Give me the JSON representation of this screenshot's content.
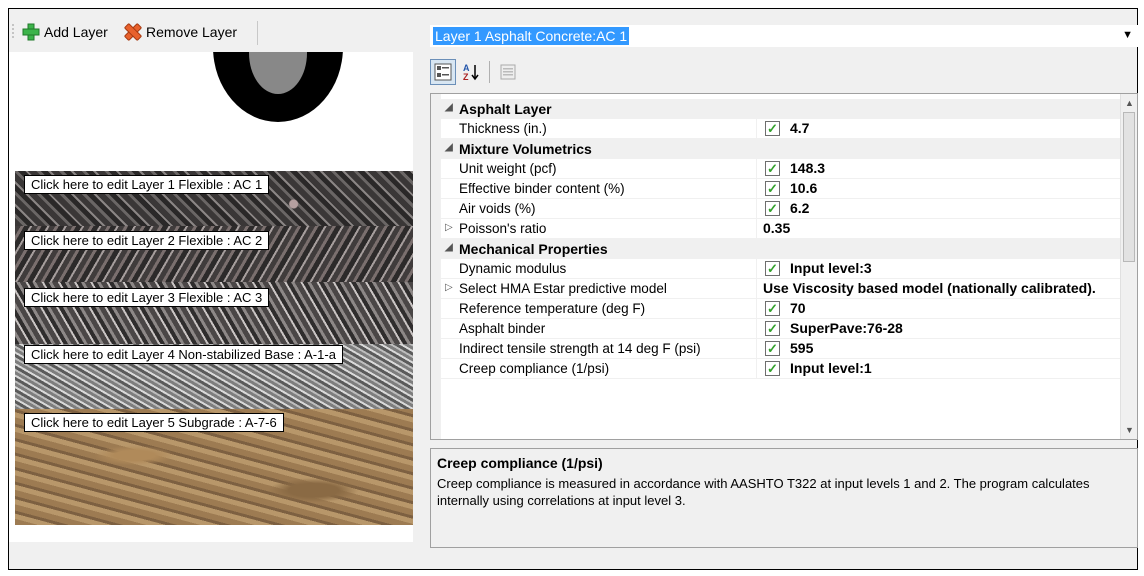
{
  "toolbar": {
    "add_label": "Add Layer",
    "remove_label": "Remove Layer"
  },
  "layers": [
    {
      "label": "Click here to edit Layer 1 Flexible : AC 1"
    },
    {
      "label": "Click here to edit Layer 2 Flexible : AC 2"
    },
    {
      "label": "Click here to edit Layer 3 Flexible : AC 3"
    },
    {
      "label": "Click here to edit Layer 4 Non-stabilized Base : A-1-a"
    },
    {
      "label": "Click here to edit Layer 5 Subgrade : A-7-6"
    }
  ],
  "selector": {
    "value": "Layer 1 Asphalt Concrete:AC 1"
  },
  "property_grid": {
    "rows": [
      {
        "type": "category",
        "name": "Asphalt Layer",
        "expander": "◢"
      },
      {
        "type": "prop",
        "name": "Thickness (in.)",
        "value": "4.7",
        "checked": true
      },
      {
        "type": "category",
        "name": "Mixture Volumetrics",
        "expander": "◢"
      },
      {
        "type": "prop",
        "name": "Unit weight (pcf)",
        "value": "148.3",
        "checked": true
      },
      {
        "type": "prop",
        "name": "Effective binder content (%)",
        "value": "10.6",
        "checked": true
      },
      {
        "type": "prop",
        "name": "Air voids (%)",
        "value": "6.2",
        "checked": true
      },
      {
        "type": "prop",
        "name": "Poisson's ratio",
        "value": "0.35",
        "checked": false,
        "expander": "▷"
      },
      {
        "type": "category",
        "name": "Mechanical Properties",
        "expander": "◢"
      },
      {
        "type": "prop",
        "name": "Dynamic modulus",
        "value": "Input level:3",
        "checked": true
      },
      {
        "type": "prop",
        "name": "Select HMA Estar predictive model",
        "value": "Use Viscosity based model (nationally calibrated).",
        "checked": false,
        "expander": "▷"
      },
      {
        "type": "prop",
        "name": "Reference temperature (deg F)",
        "value": "70",
        "checked": true
      },
      {
        "type": "prop",
        "name": "Asphalt binder",
        "value": "SuperPave:76-28",
        "checked": true
      },
      {
        "type": "prop",
        "name": "Indirect tensile strength at 14 deg F (psi)",
        "value": "595",
        "checked": true
      },
      {
        "type": "prop",
        "name": "Creep compliance (1/psi)",
        "value": "Input level:1",
        "checked": true
      }
    ]
  },
  "help": {
    "title": "Creep compliance (1/psi)",
    "description": "Creep compliance is measured in accordance with AASHTO T322 at input levels 1 and 2. The program calculates internally using correlations at input level 3."
  },
  "colors": {
    "selection": "#3399ff",
    "check": "#33a02c",
    "add_icon": "#3cb34a",
    "remove_icon": "#e8612c"
  }
}
